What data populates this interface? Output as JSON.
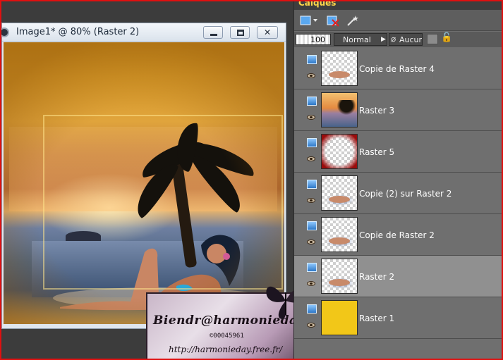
{
  "window": {
    "title": "Image1* @  80% (Raster 2)",
    "minimize_glyph": "minimize-icon",
    "maximize_glyph": "maximize-icon",
    "close_glyph": "✕"
  },
  "watermark": {
    "signature": "Biendr@harmonieday",
    "copyright": "©00045961",
    "url": "http://harmonieday.free.fr/"
  },
  "layers_panel": {
    "title": "Calques",
    "opacity": "100",
    "blend_mode": "Normal",
    "lock_mode": "Aucun",
    "layers": [
      {
        "name": "Copie de Raster 4",
        "thumb": "figure",
        "selected": false
      },
      {
        "name": "Raster 3",
        "thumb": "sunset",
        "selected": false
      },
      {
        "name": "Raster 5",
        "thumb": "red-frame",
        "selected": false
      },
      {
        "name": "Copie (2) sur Raster 2",
        "thumb": "blue-figure",
        "selected": false
      },
      {
        "name": "Copie de Raster 2",
        "thumb": "blue-figure",
        "selected": false
      },
      {
        "name": "Raster 2",
        "thumb": "blue-figure",
        "selected": true
      },
      {
        "name": "Raster 1",
        "thumb": "yellow",
        "selected": false
      }
    ]
  },
  "colors": {
    "frame_border": "#e01010",
    "panel_title": "#ffd84a",
    "panel_bg": "#6f6f6f",
    "selected_layer": "#909090",
    "raster1_fill": "#f2c718"
  }
}
